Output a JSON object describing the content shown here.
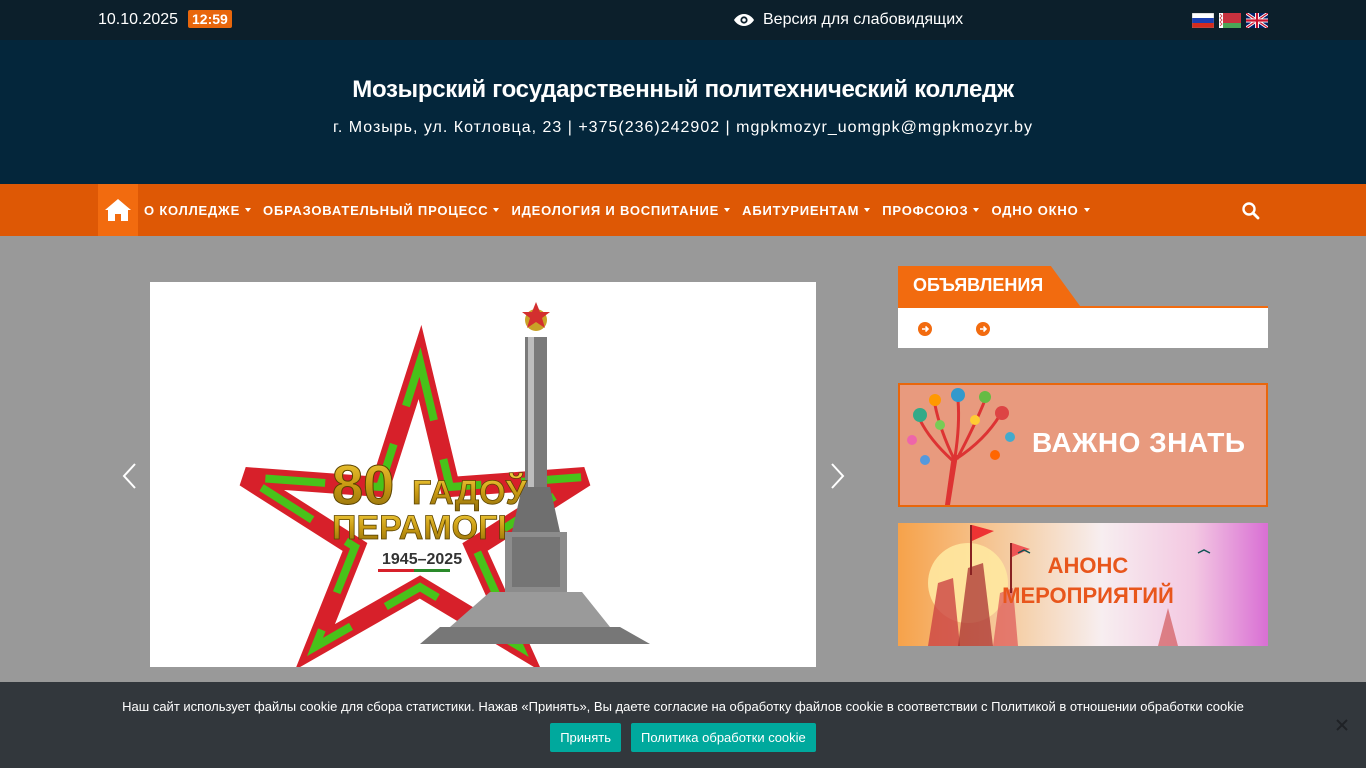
{
  "topbar": {
    "date": "10.10.2025",
    "time": "12:59",
    "accessibility_label": "Версия для слабовидящих",
    "languages": [
      "ru",
      "be",
      "en"
    ]
  },
  "header": {
    "title": "Мозырский государственный политехнический колледж",
    "description": "г. Мозырь, ул. Котловца, 23 | +375(236)242902 | mgpkmozyr_uomgpk@mgpkmozyr.by"
  },
  "nav": {
    "items": [
      {
        "label": "О КОЛЛЕДЖЕ"
      },
      {
        "label": "ОБРАЗОВАТЕЛЬНЫЙ ПРОЦЕСС"
      },
      {
        "label": "ИДЕОЛОГИЯ И ВОСПИТАНИЕ"
      },
      {
        "label": "АБИТУРИЕНТАМ"
      },
      {
        "label": "ПРОФСОЮЗ"
      },
      {
        "label": "ОДНО ОКНО"
      }
    ]
  },
  "slider": {
    "slide_text_main": "80 ГАДОЎ ПЕРАМОГІ",
    "slide_text_line1": "80",
    "slide_text_line1b": "ГАДОЎ",
    "slide_text_line2": "ПЕРАМОГІ",
    "slide_years": "1945–2025"
  },
  "sidebar": {
    "announcements_title": "ОБЪЯВЛЕНИЯ",
    "banner1_text": "ВАЖНО ЗНАТЬ",
    "banner2_line1": "АНОНС",
    "banner2_line2": "МЕРОПРИЯТИЙ"
  },
  "cookie": {
    "message": "Наш сайт использует файлы cookie для сбора статистики. Нажав «Принять», Вы даете согласие на обработку файлов cookie в соответствии с Политикой в отношении обработки cookie",
    "accept_label": "Принять",
    "policy_label": "Политика обработки cookie"
  },
  "colors": {
    "topbar_bg": "#0c1f2b",
    "header_bg": "#04263b",
    "nav_bg": "#de5805",
    "accent": "#f26b0f",
    "cookie_btn": "#00a99d"
  },
  "icons": [
    "eye-icon",
    "home-icon",
    "search-icon",
    "chevron-left-icon",
    "chevron-right-icon",
    "arrow-circle-right-icon",
    "close-icon"
  ]
}
